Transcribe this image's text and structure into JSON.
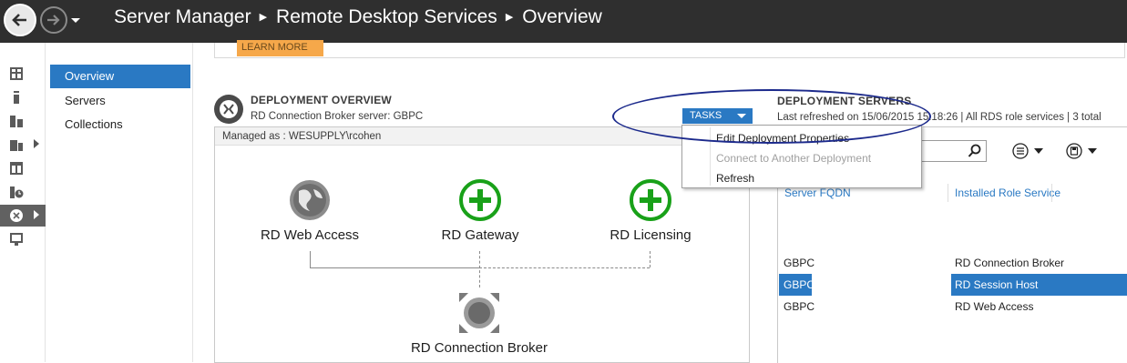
{
  "titlebar": {
    "crumbs": [
      "Server Manager",
      "Remote Desktop Services",
      "Overview"
    ]
  },
  "rail": {
    "items": [
      {
        "icon": "dashboard-icon"
      },
      {
        "icon": "local-server-icon"
      },
      {
        "icon": "all-servers-icon"
      },
      {
        "icon": "file-storage-icon"
      },
      {
        "icon": "iis-icon"
      },
      {
        "icon": "server-clock-icon"
      },
      {
        "icon": "remote-desktop-services-icon"
      },
      {
        "icon": "wsus-icon"
      }
    ]
  },
  "leftnav": {
    "items": [
      "Overview",
      "Servers",
      "Collections"
    ],
    "selected": "Overview"
  },
  "content": {
    "learn_more": "LEARN MORE",
    "overview": {
      "title": "DEPLOYMENT OVERVIEW",
      "subtitle": "RD Connection Broker server: GBPC",
      "tasks_label": "TASKS",
      "managed_as": "Managed as : WESUPPLY\\rcohen",
      "roles": {
        "web_access": "RD Web Access",
        "gateway": "RD Gateway",
        "licensing": "RD Licensing",
        "broker": "RD Connection Broker"
      }
    },
    "servers": {
      "title": "DEPLOYMENT SERVERS",
      "subtitle": "Last refreshed on 15/06/2015 15:18:26 | All RDS role services | 3 total",
      "columns": [
        "Server FQDN",
        "Installed Role Service"
      ],
      "rows": [
        {
          "fqdn": "GBPC",
          "role": "RD Connection Broker"
        },
        {
          "fqdn": "GBPC",
          "role": "RD Session Host"
        },
        {
          "fqdn": "GBPC",
          "role": "RD Web Access"
        }
      ]
    }
  },
  "tasks_menu": {
    "items": [
      {
        "label": "Edit Deployment Properties",
        "enabled": true
      },
      {
        "label": "Connect to Another Deployment",
        "enabled": false
      },
      {
        "label": "Refresh",
        "enabled": true
      }
    ]
  },
  "colors": {
    "titlebar": "#2f2f2f",
    "accent": "#2a79c3",
    "learn_more": "#f6a84a",
    "plus_green": "#19a119",
    "annotation": "#1c2a8c"
  }
}
